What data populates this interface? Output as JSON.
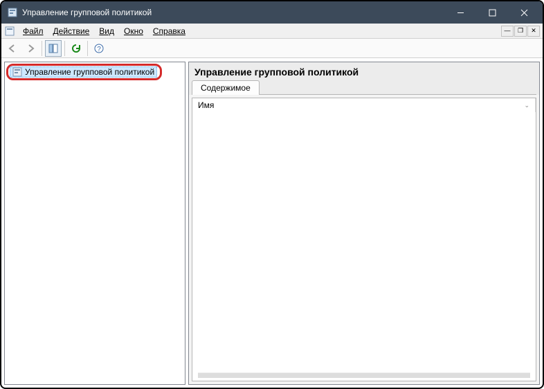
{
  "titlebar": {
    "title": "Управление групповой политикой"
  },
  "menu": {
    "file": "Файл",
    "action": "Действие",
    "view": "Вид",
    "window": "Окно",
    "help": "Справка"
  },
  "tree": {
    "root_label": "Управление групповой политикой"
  },
  "content": {
    "heading": "Управление групповой политикой",
    "tab_contents": "Содержимое",
    "col_name": "Имя"
  }
}
